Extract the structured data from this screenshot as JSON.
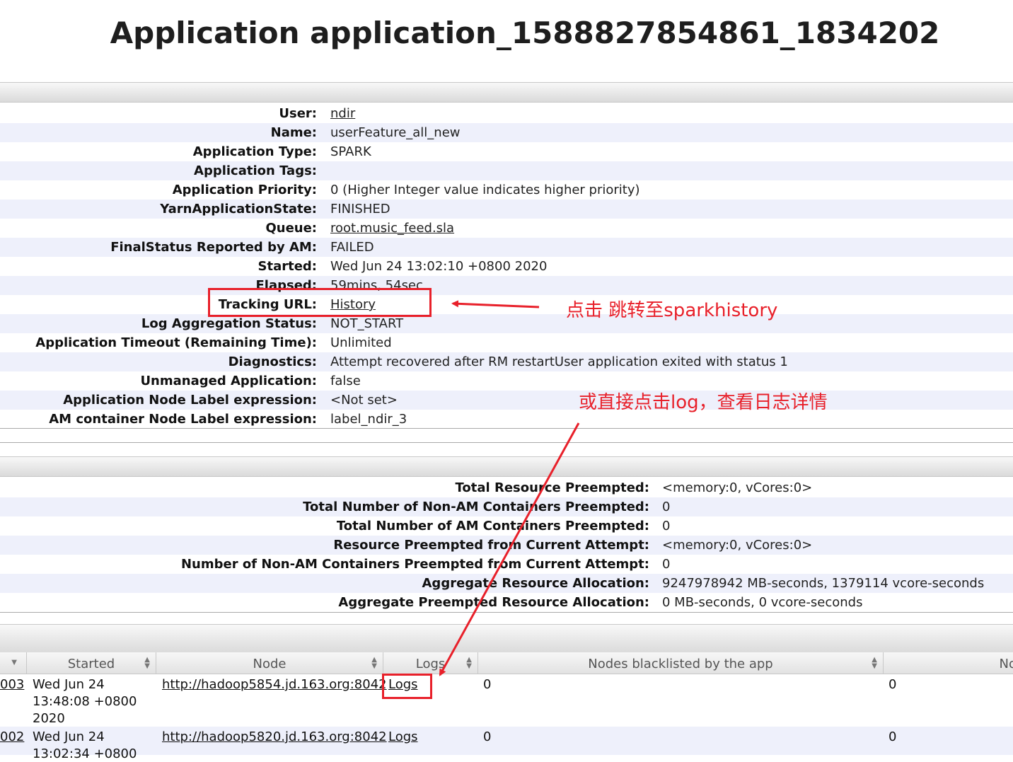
{
  "page": {
    "title": "Application application_1588827854861_1834202"
  },
  "overview": [
    {
      "label": "User:",
      "value": "ndir",
      "link": true
    },
    {
      "label": "Name:",
      "value": "userFeature_all_new"
    },
    {
      "label": "Application Type:",
      "value": "SPARK"
    },
    {
      "label": "Application Tags:",
      "value": ""
    },
    {
      "label": "Application Priority:",
      "value": "0 (Higher Integer value indicates higher priority)"
    },
    {
      "label": "YarnApplicationState:",
      "value": "FINISHED"
    },
    {
      "label": "Queue:",
      "value": "root.music_feed.sla",
      "link": true
    },
    {
      "label": "FinalStatus Reported by AM:",
      "value": "FAILED"
    },
    {
      "label": "Started:",
      "value": "Wed Jun 24 13:02:10 +0800 2020"
    },
    {
      "label": "Elapsed:",
      "value": "59mins, 54sec"
    },
    {
      "label": "Tracking URL:",
      "value": "History",
      "link": true
    },
    {
      "label": "Log Aggregation Status:",
      "value": "NOT_START"
    },
    {
      "label": "Application Timeout (Remaining Time):",
      "value": "Unlimited"
    },
    {
      "label": "Diagnostics:",
      "value": "Attempt recovered after RM restartUser application exited with status 1"
    },
    {
      "label": "Unmanaged Application:",
      "value": "false"
    },
    {
      "label": "Application Node Label expression:",
      "value": "<Not set>"
    },
    {
      "label": "AM container Node Label expression:",
      "value": "label_ndir_3"
    }
  ],
  "metrics": [
    {
      "label": "Total Resource Preempted:",
      "value": "<memory:0, vCores:0>"
    },
    {
      "label": "Total Number of Non-AM Containers Preempted:",
      "value": "0"
    },
    {
      "label": "Total Number of AM Containers Preempted:",
      "value": "0"
    },
    {
      "label": "Resource Preempted from Current Attempt:",
      "value": "<memory:0, vCores:0>"
    },
    {
      "label": "Number of Non-AM Containers Preempted from Current Attempt:",
      "value": "0"
    },
    {
      "label": "Aggregate Resource Allocation:",
      "value": "9247978942 MB-seconds, 1379114 vcore-seconds"
    },
    {
      "label": "Aggregate Preempted Resource Allocation:",
      "value": "0 MB-seconds, 0 vcore-seconds"
    }
  ],
  "attempts": {
    "columns": {
      "started": "Started",
      "node": "Node",
      "logs": "Logs",
      "blacklisted": "Nodes blacklisted by the app",
      "next": "No"
    },
    "rows": [
      {
        "id": "003",
        "started": [
          "Wed Jun 24",
          "13:48:08 +0800",
          "2020"
        ],
        "node": "http://hadoop5854.jd.163.org:8042",
        "logs": "Logs",
        "blacklisted": "0",
        "next": "0"
      },
      {
        "id": "002",
        "started": [
          "Wed Jun 24",
          "13:02:34 +0800"
        ],
        "node": "http://hadoop5820.jd.163.org:8042",
        "logs": "Logs",
        "blacklisted": "0",
        "next": "0"
      }
    ]
  },
  "annotations": {
    "tracking_note": "点击 跳转至sparkhistory",
    "logs_note": "或直接点击log，查看日志详情",
    "color": "#e8202a"
  }
}
